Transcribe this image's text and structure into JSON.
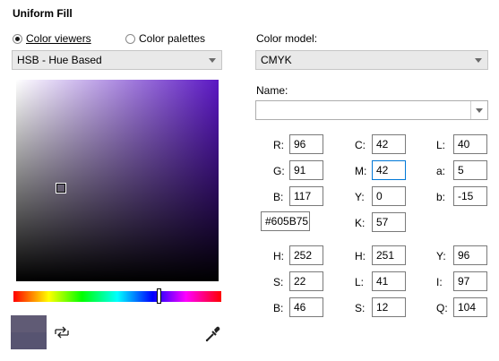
{
  "dialog": {
    "title": "Uniform Fill"
  },
  "viewer_mode": {
    "color_viewers_label": "Color viewers",
    "color_palettes_label": "Color palettes",
    "selected": "Color viewers"
  },
  "viewer_select": {
    "value": "HSB - Hue Based"
  },
  "color_model": {
    "label": "Color model:",
    "value": "CMYK"
  },
  "name": {
    "label": "Name:",
    "value": ""
  },
  "colors": {
    "current": "#605B75",
    "reference": "#575471",
    "hue_spectrum_hue_deg": 252
  },
  "icons": {
    "swap": "swap-arrows-icon",
    "eyedropper": "eyedropper-icon"
  },
  "values": {
    "rgb": {
      "r_label": "R:",
      "r": "96",
      "g_label": "G:",
      "g": "91",
      "b_label": "B:",
      "b": "117"
    },
    "hex": "#605B75",
    "cmyk": {
      "c_label": "C:",
      "c": "42",
      "m_label": "M:",
      "m": "42",
      "y_label": "Y:",
      "y": "0",
      "k_label": "K:",
      "k": "57"
    },
    "lab": {
      "l_label": "L:",
      "l": "40",
      "a_label": "a:",
      "a": "5",
      "b_label": "b:",
      "b": "-15"
    },
    "hsb": {
      "h_label": "H:",
      "h": "252",
      "s_label": "S:",
      "s": "22",
      "b_label": "B:",
      "b": "46"
    },
    "hls": {
      "h_label": "H:",
      "h": "251",
      "l_label": "L:",
      "l": "41",
      "s_label": "S:",
      "s": "12"
    },
    "yiq": {
      "y_label": "Y:",
      "y": "96",
      "i_label": "I:",
      "i": "97",
      "q_label": "Q:",
      "q": "104"
    }
  }
}
